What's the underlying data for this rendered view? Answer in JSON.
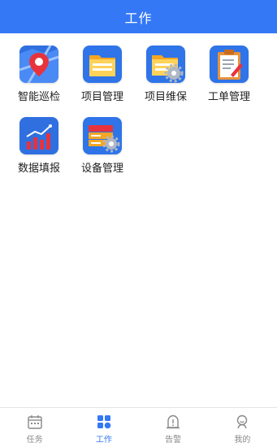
{
  "header": {
    "title": "工作"
  },
  "apps": [
    {
      "label": "智能巡检",
      "icon": "map-pin-icon"
    },
    {
      "label": "项目管理",
      "icon": "folder-icon"
    },
    {
      "label": "项目维保",
      "icon": "folder-gear-icon"
    },
    {
      "label": "工单管理",
      "icon": "clipboard-icon"
    },
    {
      "label": "数据填报",
      "icon": "bar-chart-icon"
    },
    {
      "label": "设备管理",
      "icon": "device-gear-icon"
    }
  ],
  "tabbar": {
    "active": "工作",
    "items": [
      {
        "label": "任务",
        "icon": "calendar-icon"
      },
      {
        "label": "工作",
        "icon": "grid-icon"
      },
      {
        "label": "告警",
        "icon": "alarm-icon"
      },
      {
        "label": "我的",
        "icon": "user-icon"
      }
    ]
  },
  "colors": {
    "primary": "#3478f6",
    "tab_inactive": "#888888",
    "text": "#222222"
  }
}
